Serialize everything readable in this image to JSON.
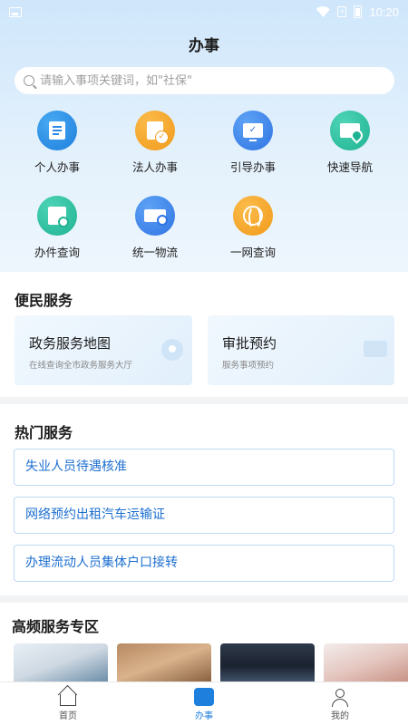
{
  "status_bar": {
    "time": "10:20"
  },
  "header": {
    "title": "办事"
  },
  "search": {
    "placeholder": "请输入事项关键词，如\"社保\""
  },
  "services_grid": [
    {
      "label": "个人办事",
      "icon": "list-doc-icon",
      "color": "#1e7fdc"
    },
    {
      "label": "法人办事",
      "icon": "badge-check-icon",
      "color": "#f19a1a"
    },
    {
      "label": "引导办事",
      "icon": "monitor-check-icon",
      "color": "#2f74e3"
    },
    {
      "label": "快速导航",
      "icon": "card-location-icon",
      "color": "#1eb393"
    },
    {
      "label": "办件查询",
      "icon": "doc-search-icon",
      "color": "#1eb393"
    },
    {
      "label": "统一物流",
      "icon": "truck-search-icon",
      "color": "#2f74e3"
    },
    {
      "label": "一网查询",
      "icon": "globe-location-icon",
      "color": "#f19a1a"
    }
  ],
  "convenience": {
    "title": "便民服务",
    "cards": [
      {
        "title": "政务服务地图",
        "subtitle": "在线查询全市政务服务大厅"
      },
      {
        "title": "审批预约",
        "subtitle": "服务事项预约"
      }
    ]
  },
  "hot": {
    "title": "热门服务",
    "items": [
      "失业人员待遇核准",
      "网络预约出租汽车运输证",
      "办理流动人员集体户口接转"
    ]
  },
  "frequent": {
    "title": "高频服务专区"
  },
  "tabbar": {
    "items": [
      {
        "label": "首页",
        "icon": "home-icon"
      },
      {
        "label": "办事",
        "icon": "work-icon"
      },
      {
        "label": "我的",
        "icon": "person-icon"
      }
    ]
  }
}
